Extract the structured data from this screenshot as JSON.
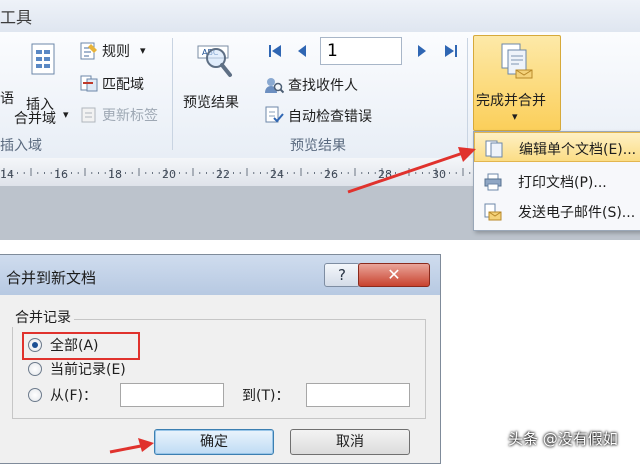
{
  "titlebar": {
    "text": "工具"
  },
  "ribbon": {
    "partial_label": "语",
    "insert_field": {
      "line1": "插入",
      "line2": "合并域",
      "arrow": "▾"
    },
    "rules_label": "规则",
    "rules_arrow": "▾",
    "match_fields_label": "匹配域",
    "update_labels_label": "更新标签",
    "group_insert_field_label": "插入域",
    "preview_results_label": "预览结果",
    "record_number": "1",
    "find_recipient_label": "查找收件人",
    "auto_check_errors_label": "自动检查错误",
    "group_preview_label": "预览结果",
    "finish_merge": {
      "label": "完成并合并",
      "arrow": "▾"
    }
  },
  "ruler": {
    "labels": [
      "14",
      "16",
      "18",
      "20",
      "22",
      "24",
      "26",
      "28",
      "30",
      "32",
      "34",
      "36",
      "38"
    ]
  },
  "dropdown": {
    "items": [
      {
        "label": "编辑单个文档(E)...",
        "icon": "edit-documents-icon"
      },
      {
        "label": "打印文档(P)...",
        "icon": "print-documents-icon"
      },
      {
        "label": "发送电子邮件(S)...",
        "icon": "send-email-icon"
      }
    ]
  },
  "dialog": {
    "title": "合并到新文档",
    "help_label": "?",
    "close_label": "✕",
    "group_label": "合并记录",
    "options": {
      "all": "全部(A)",
      "current": "当前记录(E)",
      "from": "从(F)："
    },
    "to_label": "到(T)：",
    "from_value": "",
    "to_value": "",
    "ok_label": "确定",
    "cancel_label": "取消"
  },
  "watermark": "头条 @没有假如",
  "colors": {
    "annotation_red": "#e0322d",
    "highlight": "#fbdd85"
  }
}
